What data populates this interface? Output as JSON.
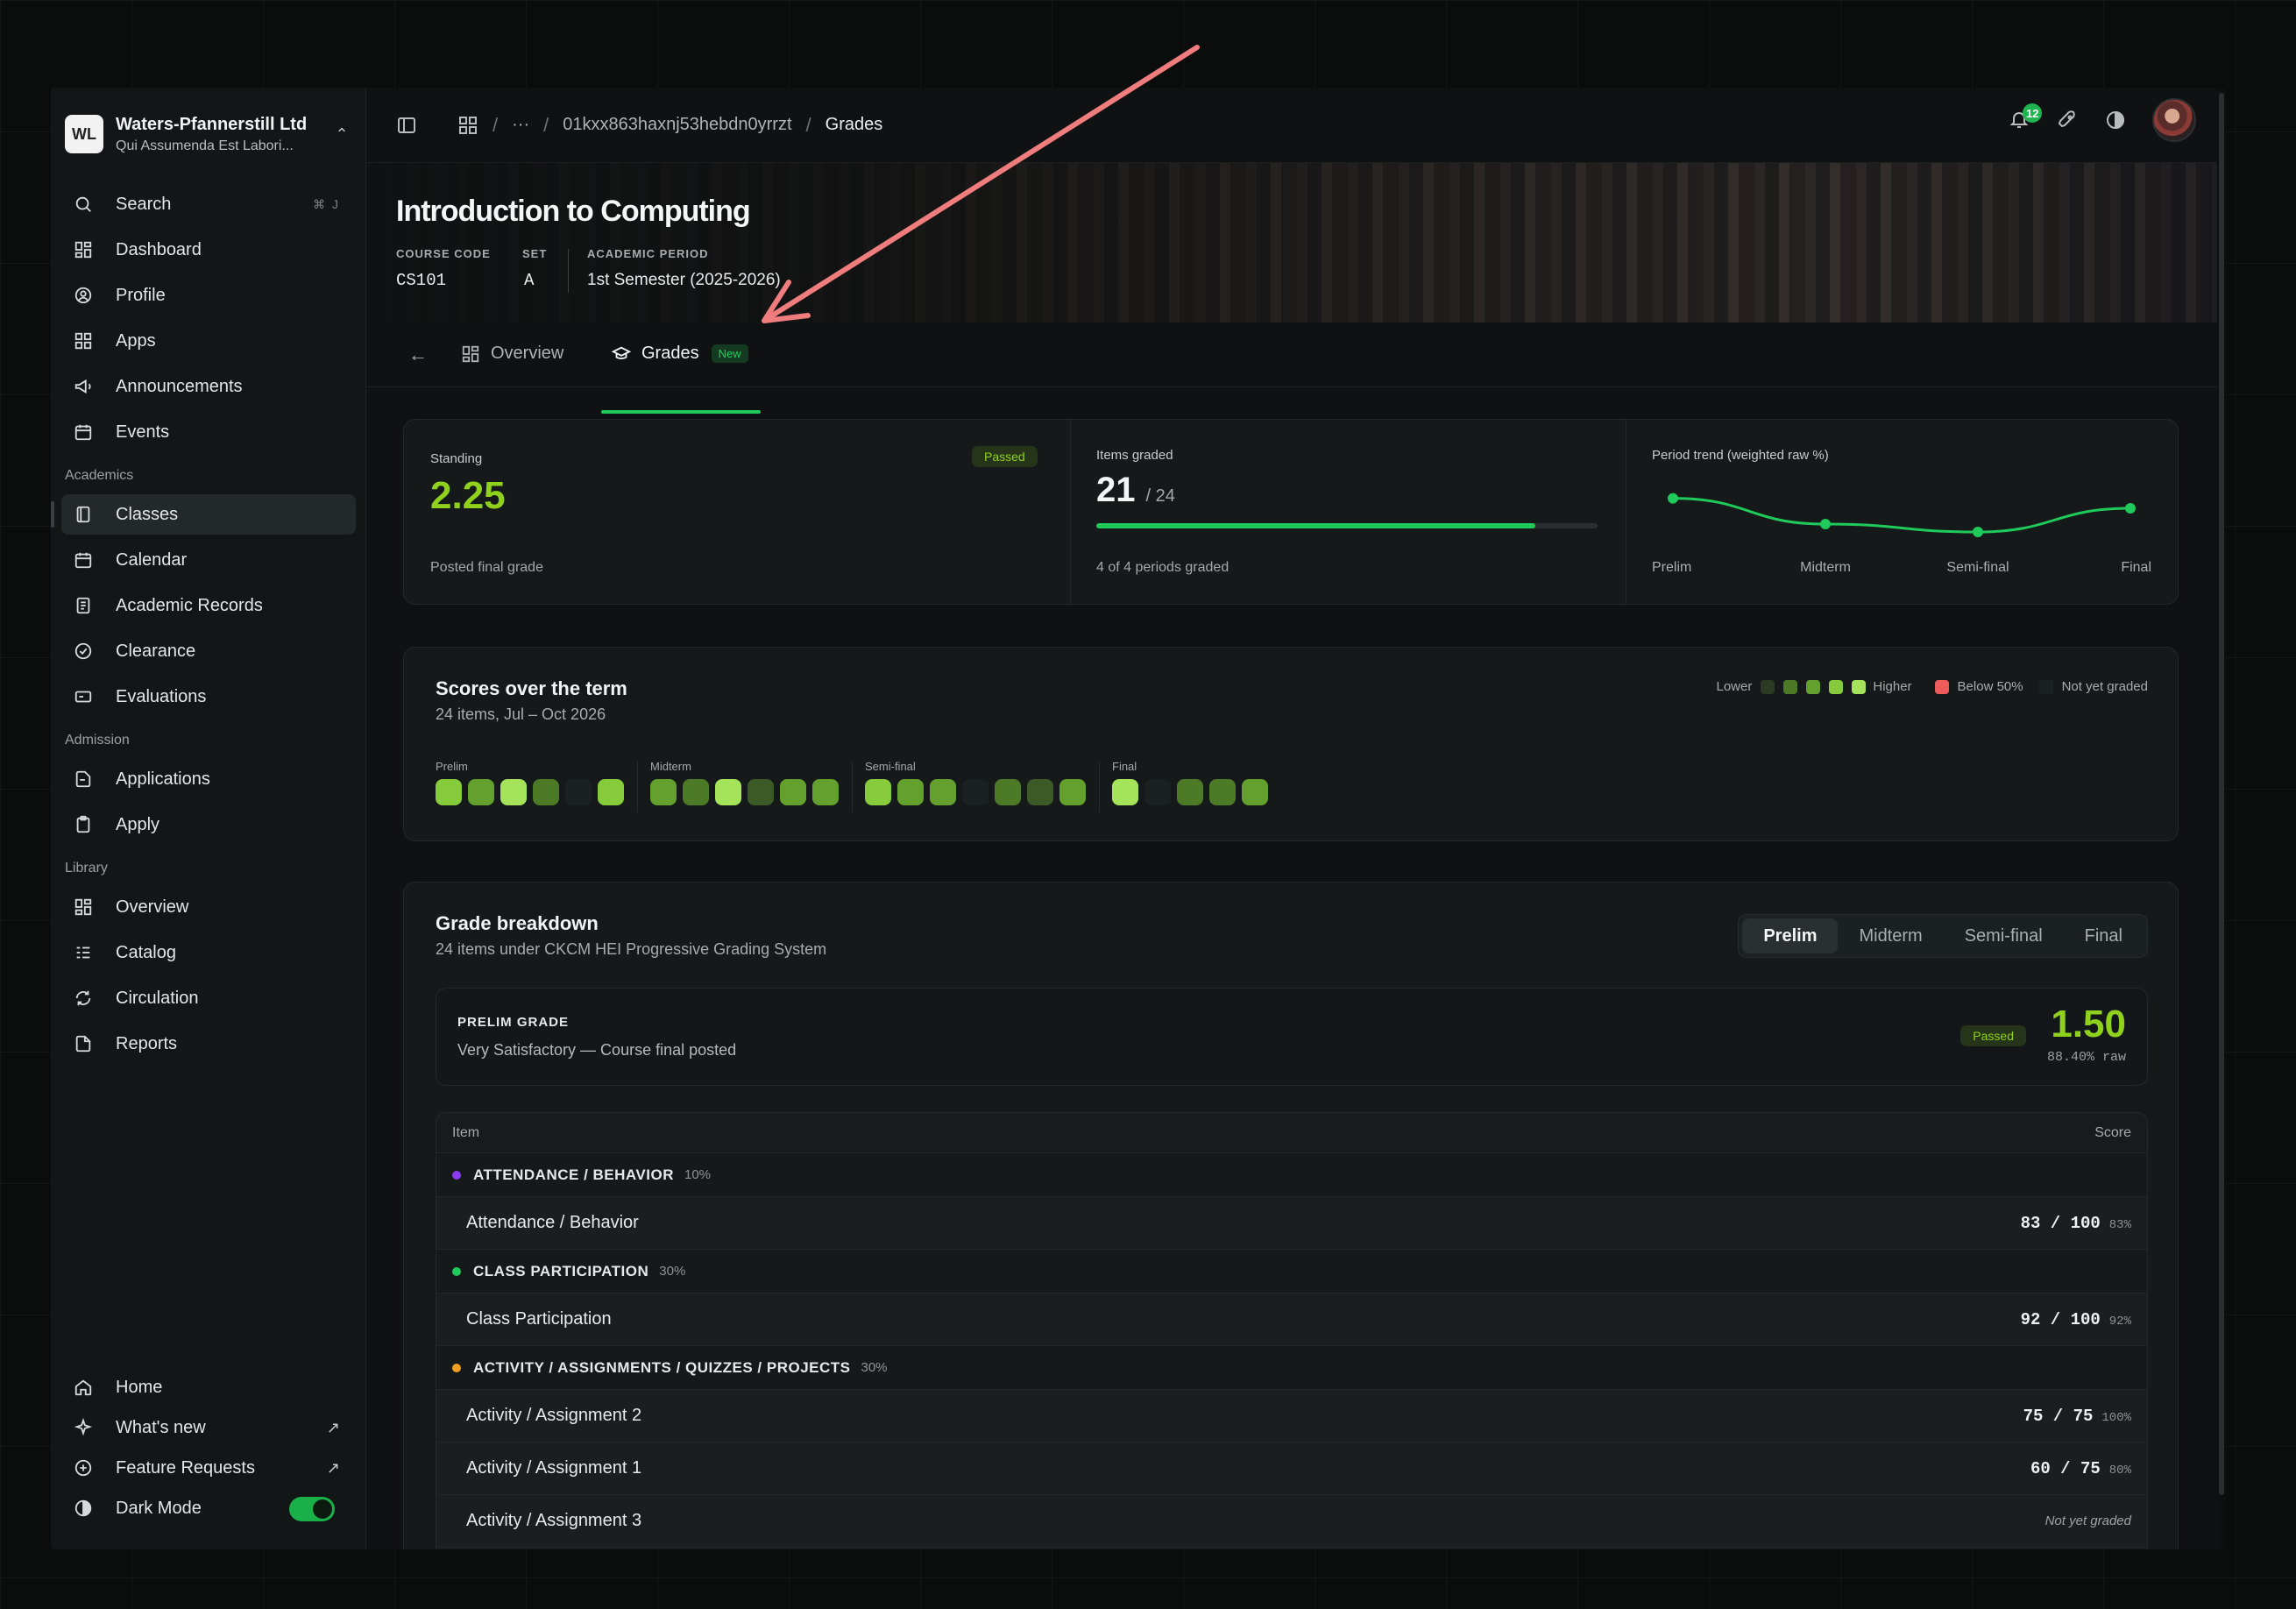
{
  "org": {
    "initials": "WL",
    "name": "Waters-Pfannerstill Ltd",
    "subtitle": "Qui Assumenda Est Labori..."
  },
  "sidebar": {
    "top": [
      {
        "label": "Search",
        "kbd": "⌘ J"
      },
      {
        "label": "Dashboard"
      },
      {
        "label": "Profile"
      },
      {
        "label": "Apps"
      },
      {
        "label": "Announcements"
      },
      {
        "label": "Events"
      }
    ],
    "academics_label": "Academics",
    "academics": [
      {
        "label": "Classes"
      },
      {
        "label": "Calendar"
      },
      {
        "label": "Academic Records"
      },
      {
        "label": "Clearance"
      },
      {
        "label": "Evaluations"
      }
    ],
    "admission_label": "Admission",
    "admission": [
      {
        "label": "Applications"
      },
      {
        "label": "Apply"
      }
    ],
    "library_label": "Library",
    "library": [
      {
        "label": "Overview"
      },
      {
        "label": "Catalog"
      },
      {
        "label": "Circulation"
      },
      {
        "label": "Reports"
      }
    ],
    "bottom": [
      {
        "label": "Home"
      },
      {
        "label": "What's new",
        "arrow": "↗"
      },
      {
        "label": "Feature Requests",
        "arrow": "↗"
      },
      {
        "label": "Dark Mode"
      }
    ],
    "dark_mode_on": true
  },
  "topbar": {
    "crumb_id": "01kxx863haxnj53hebdn0yrrzt",
    "crumb_more": "···",
    "crumb_current": "Grades",
    "notifications": "12"
  },
  "course": {
    "title": "Introduction to Computing",
    "code_label": "COURSE CODE",
    "code": "CS101",
    "set_label": "SET",
    "set": "A",
    "period_label": "ACADEMIC PERIOD",
    "period": "1st Semester (2025-2026)"
  },
  "tabs": [
    {
      "label": "Overview"
    },
    {
      "label": "Grades",
      "badge": "New"
    }
  ],
  "summary": {
    "standing_label": "Standing",
    "standing_status": "Passed",
    "standing_value": "2.25",
    "standing_sub": "Posted final grade",
    "items_label": "Items graded",
    "items_value": "21",
    "items_total": "/ 24",
    "items_progress": 0.875,
    "items_sub": "4 of 4 periods graded",
    "trend_label": "Period trend (weighted raw %)",
    "trend_periods": [
      "Prelim",
      "Midterm",
      "Semi-final",
      "Final"
    ]
  },
  "chart_data": {
    "type": "line",
    "title": "Period trend (weighted raw %)",
    "categories": [
      "Prelim",
      "Midterm",
      "Semi-final",
      "Final"
    ],
    "values": [
      88.4,
      83.5,
      82.0,
      86.5
    ],
    "ylim": [
      80,
      90
    ],
    "grid": false
  },
  "scores": {
    "title": "Scores over the term",
    "subtitle": "24 items, Jul – Oct 2026",
    "legend_lower": "Lower",
    "legend_higher": "Higher",
    "legend_below": "Below 50%",
    "legend_not_graded": "Not yet graded",
    "colors": [
      "#3b5a25",
      "#4d7a26",
      "#64a02d",
      "#85cb3b",
      "#a4e35a"
    ],
    "not_graded_color": "#1b2021",
    "below_color": "#ef5a5a",
    "periods": [
      {
        "label": "Prelim",
        "cells": [
          3,
          2,
          4,
          1,
          -1,
          3
        ]
      },
      {
        "label": "Midterm",
        "cells": [
          2,
          1,
          4,
          0,
          2,
          2
        ]
      },
      {
        "label": "Semi-final",
        "cells": [
          3,
          2,
          2,
          -1,
          1,
          0,
          2
        ]
      },
      {
        "label": "Final",
        "cells": [
          4,
          -1,
          1,
          1,
          2
        ]
      }
    ]
  },
  "breakdown": {
    "title": "Grade breakdown",
    "subtitle": "24 items under CKCM HEI Progressive Grading System",
    "segments": [
      "Prelim",
      "Midterm",
      "Semi-final",
      "Final"
    ],
    "active_segment": "Prelim",
    "grade_label": "PRELIM GRADE",
    "grade_desc": "Very Satisfactory — Course final posted",
    "grade_status": "Passed",
    "grade_value": "1.50",
    "grade_raw": "88.40% raw",
    "col_item": "Item",
    "col_score": "Score",
    "groups": [
      {
        "name": "ATTENDANCE / BEHAVIOR",
        "weight": "10%",
        "color": "#8b3cf0",
        "items": [
          {
            "name": "Attendance / Behavior",
            "score": "83 / 100",
            "pct": "83%"
          }
        ]
      },
      {
        "name": "CLASS PARTICIPATION",
        "weight": "30%",
        "color": "#1fc95a",
        "items": [
          {
            "name": "Class Participation",
            "score": "92 / 100",
            "pct": "92%"
          }
        ]
      },
      {
        "name": "ACTIVITY / ASSIGNMENTS / QUIZZES / PROJECTS",
        "weight": "30%",
        "color": "#f0a020",
        "items": [
          {
            "name": "Activity / Assignment 2",
            "score": "75 / 75",
            "pct": "100%"
          },
          {
            "name": "Activity / Assignment 1",
            "score": "60 / 75",
            "pct": "80%"
          },
          {
            "name": "Activity / Assignment 3",
            "score": "",
            "pct": "",
            "status": "Not yet graded"
          }
        ]
      }
    ]
  }
}
